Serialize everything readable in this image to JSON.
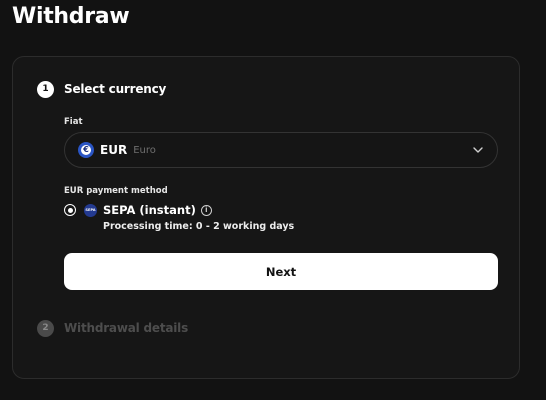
{
  "page": {
    "title": "Withdraw"
  },
  "steps": [
    {
      "number": "1",
      "title": "Select currency",
      "state": "active"
    },
    {
      "number": "2",
      "title": "Withdrawal details",
      "state": "inactive"
    }
  ],
  "currency_field": {
    "label": "Fiat",
    "selected_code": "EUR",
    "selected_name": "Euro",
    "icon": "euro-coin-icon",
    "icon_glyph": "€",
    "dropdown_icon": "chevron-down-icon"
  },
  "payment_method": {
    "label": "EUR payment method",
    "option": {
      "name": "SEPA (instant)",
      "icon": "sepa-icon",
      "logo_text": "SEPA",
      "selected": true,
      "processing_time": "Processing time: 0 - 2 working days",
      "info_icon": "info-icon",
      "info_glyph": "i"
    }
  },
  "actions": {
    "next_label": "Next"
  },
  "colors": {
    "background": "#121212",
    "card_border": "#2c2c2c",
    "primary_button": "#ffffff",
    "euro_blue": "#2a55c5",
    "sepa_blue": "#233a91",
    "inactive_text": "#4d4d4d"
  }
}
